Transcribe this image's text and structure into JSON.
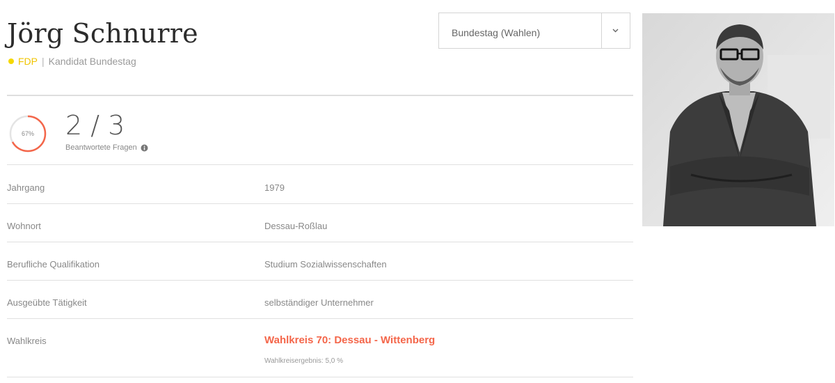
{
  "candidate": {
    "name": "Jörg Schnurre",
    "party": "FDP",
    "role": "Kandidat Bundestag",
    "separator": "|",
    "party_color": "#f5d800"
  },
  "parliament_select": {
    "selected": "Bundestag (Wahlen)"
  },
  "answers": {
    "percent_label": "67%",
    "percent": 0.67,
    "count": "2 / 3",
    "label": "Beantwortete Fragen"
  },
  "details": [
    {
      "label": "Jahrgang",
      "value": "1979"
    },
    {
      "label": "Wohnort",
      "value": "Dessau-Roßlau"
    },
    {
      "label": "Berufliche Qualifikation",
      "value": "Studium Sozialwissenschaften"
    },
    {
      "label": "Ausgeübte Tätigkeit",
      "value": "selbständiger Unternehmer"
    },
    {
      "label": "Wahlkreis",
      "value": "Wahlkreis 70: Dessau - Wittenberg",
      "sub": "Wahlkreisergebnis: 5,0 %"
    }
  ],
  "colors": {
    "accent": "#f4664a",
    "party": "#f5d800",
    "rule": "#dedede"
  },
  "icons": {
    "select_arrow": "chevron-down-icon",
    "info": "info-icon"
  }
}
